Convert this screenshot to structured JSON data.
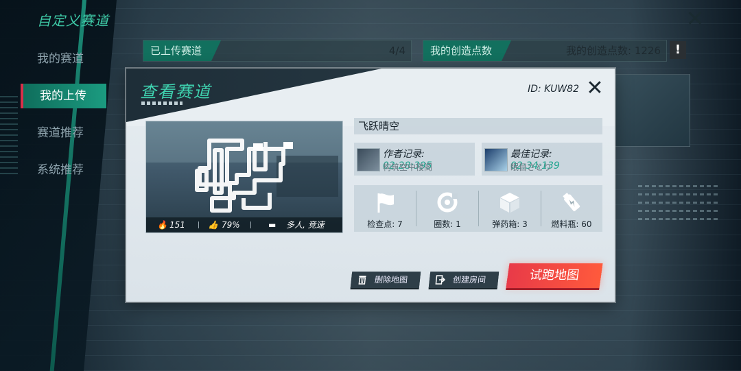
{
  "sidebar": {
    "title": "自定义赛道",
    "items": [
      {
        "label": "我的赛道"
      },
      {
        "label": "我的上传",
        "active": true
      },
      {
        "label": "赛道推荐"
      },
      {
        "label": "系统推荐"
      }
    ]
  },
  "header": {
    "uploaded_tab": "已上传赛道",
    "uploaded_count": "4/4",
    "points_tab": "我的创造点数",
    "points_text": "我的创造点数: 1226",
    "warn_icon": "exclamation-icon"
  },
  "dialog": {
    "title": "查看赛道",
    "track_id": "ID: KUW82",
    "track_name": "飞跃晴空",
    "preview": {
      "hot": "151",
      "like": "79%",
      "mode": "多人, 竞速"
    },
    "author_record": {
      "label": "作者记录:",
      "time": "02:28:395",
      "name": "构筑空中楼阁"
    },
    "best_record": {
      "label": "最佳记录:",
      "time": "02:34:139",
      "name": "眠目さとり"
    },
    "stats": [
      {
        "label": "检查点: 7",
        "icon": "flag-icon"
      },
      {
        "label": "圈数: 1",
        "icon": "loop-icon"
      },
      {
        "label": "弹药箱: 3",
        "icon": "cube-icon"
      },
      {
        "label": "燃料瓶: 60",
        "icon": "fuel-icon"
      }
    ],
    "buttons": {
      "delete": "删除地图",
      "create_room": "创建房间",
      "test_run": "试跑地图"
    }
  },
  "colors": {
    "accent_teal": "#3fd3b0",
    "primary_red": "#e83a48",
    "active_nav": "#1b9b80"
  }
}
